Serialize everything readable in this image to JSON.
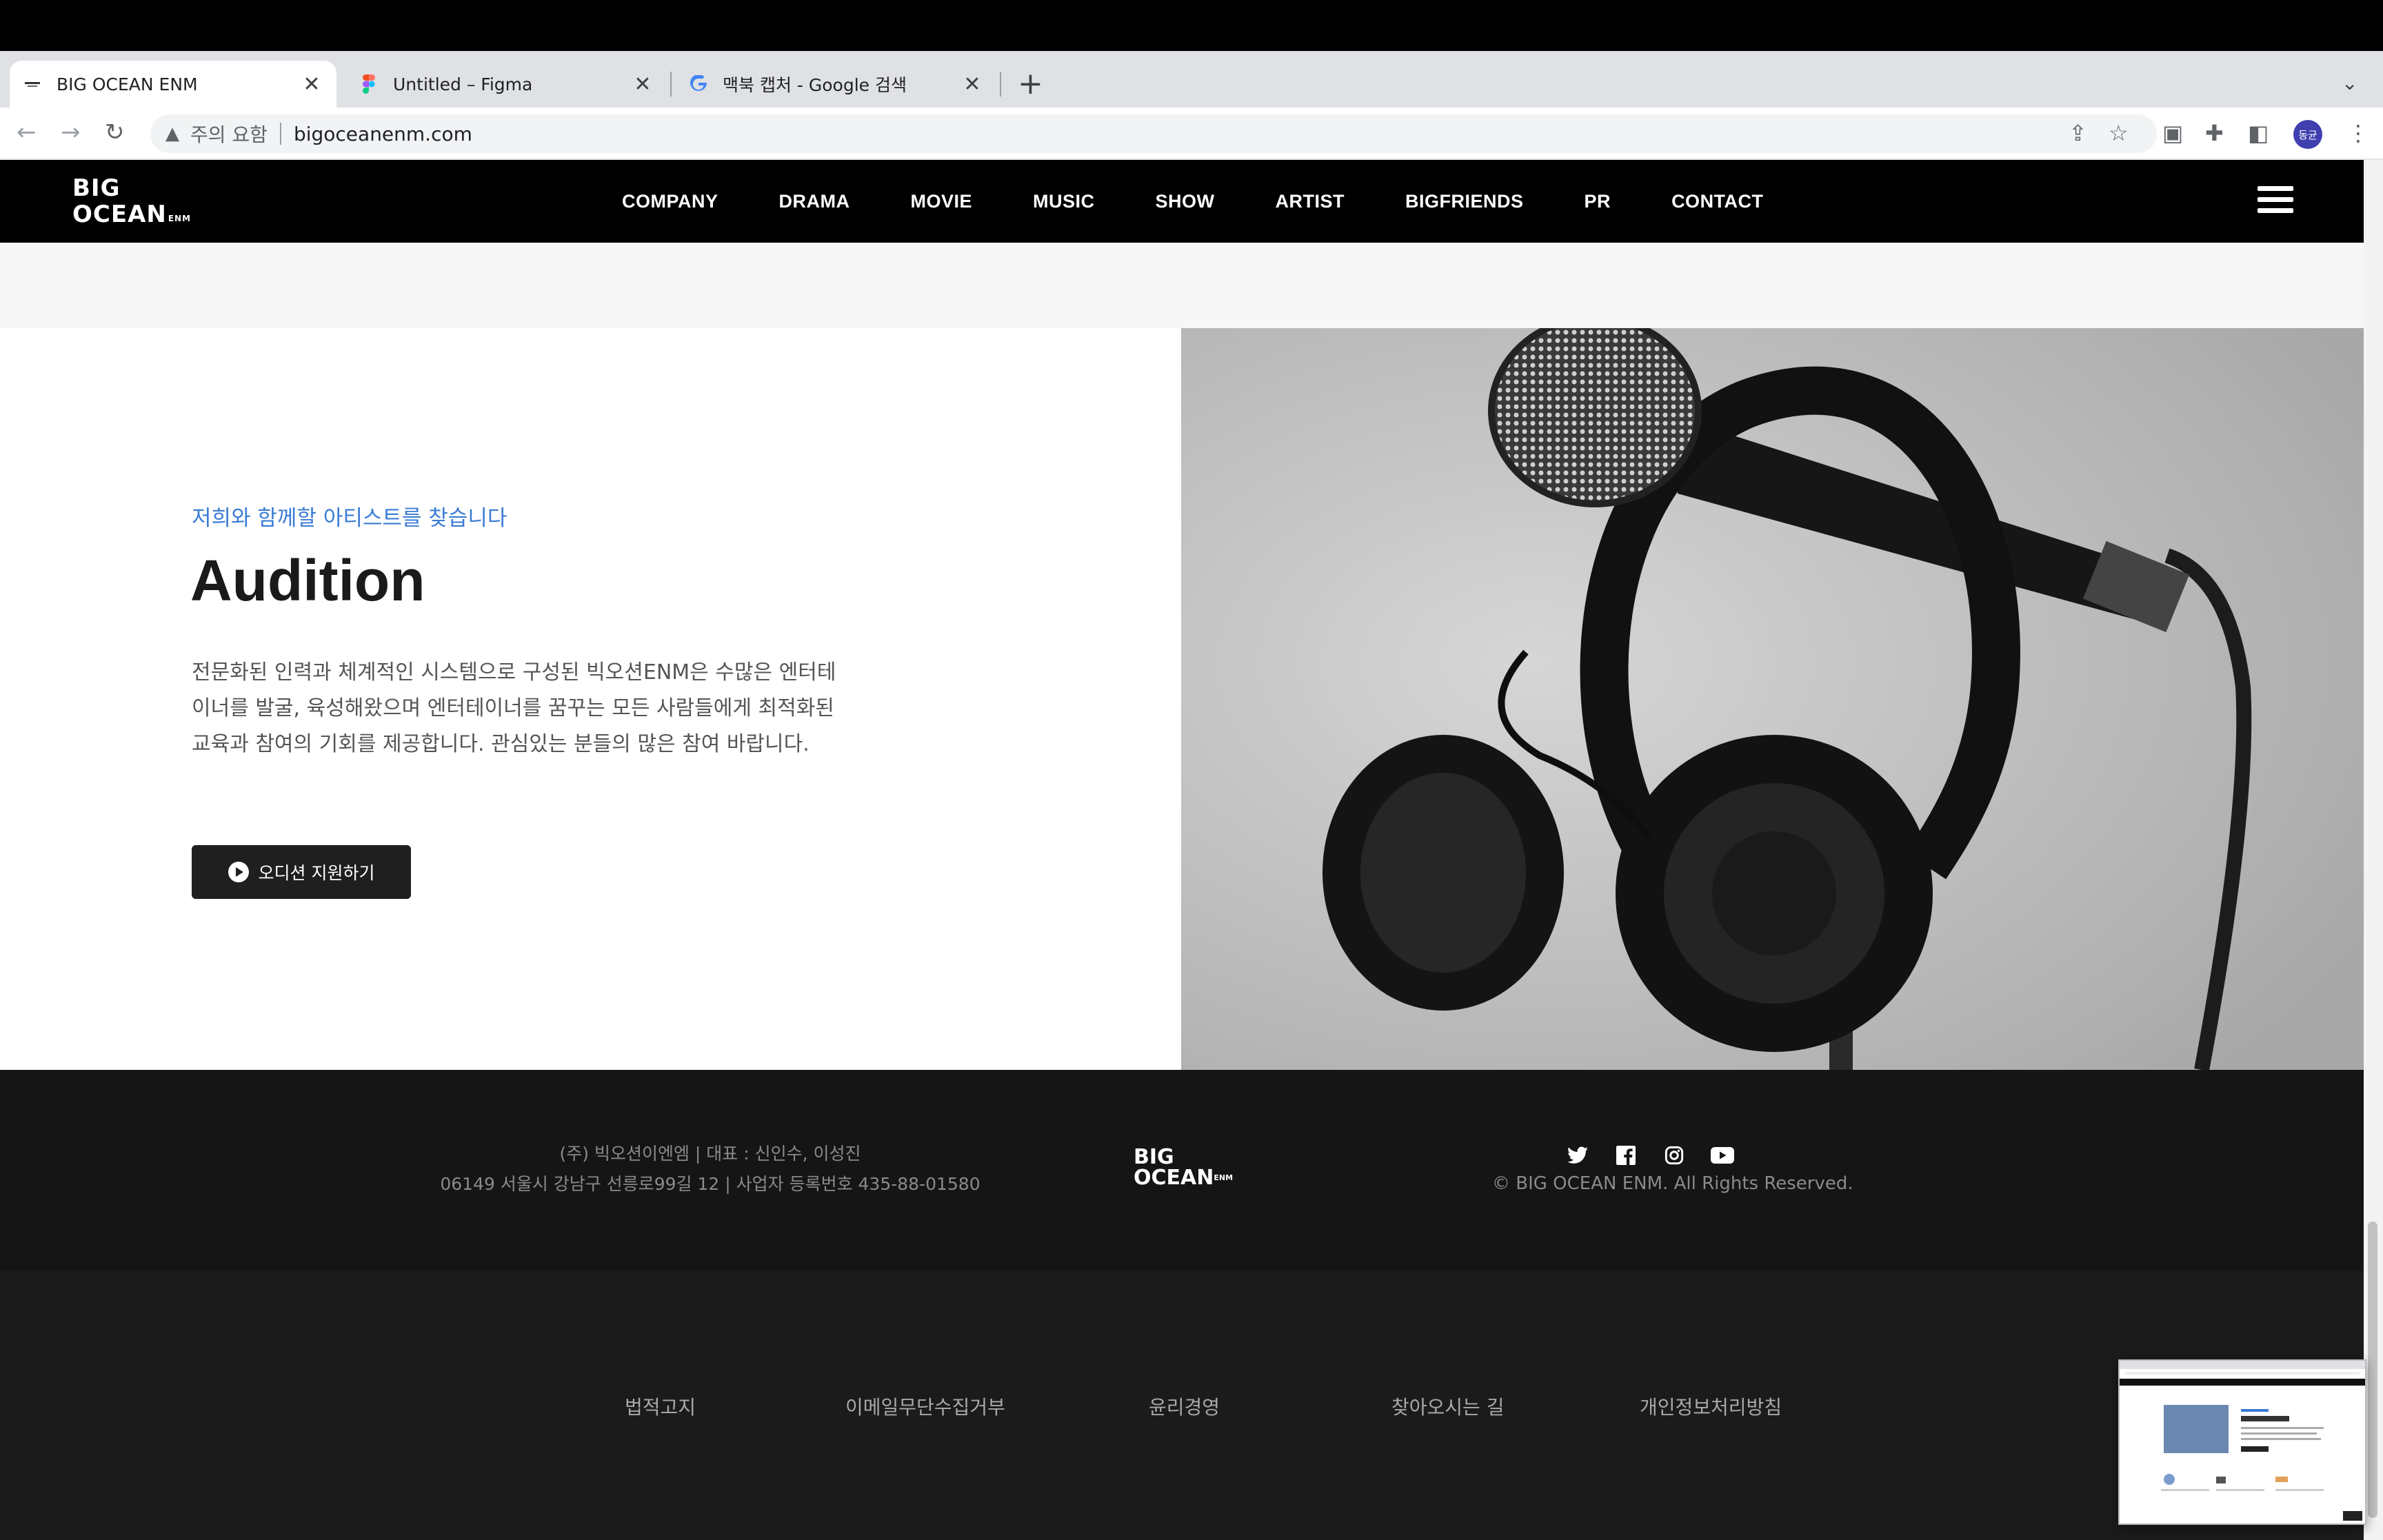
{
  "browser": {
    "tabs": [
      {
        "title": "BIG OCEAN ENM",
        "close": "✕"
      },
      {
        "title": "Untitled – Figma",
        "close": "✕"
      },
      {
        "title": "맥북 캡처 - Google 검색",
        "close": "✕"
      }
    ],
    "new_tab": "+",
    "tab_menu": "⌄",
    "back": "←",
    "forward": "→",
    "reload": "↻",
    "security_warning": "주의 요함",
    "url": "bigoceanenm.com",
    "profile_initials": "동균"
  },
  "site": {
    "logo_line1": "BIG",
    "logo_line2": "OCEAN",
    "logo_suffix": "ENM",
    "nav": [
      "COMPANY",
      "DRAMA",
      "MOVIE",
      "MUSIC",
      "SHOW",
      "ARTIST",
      "BIGFRIENDS",
      "PR",
      "CONTACT"
    ]
  },
  "audition": {
    "subtitle": "저희와 함께할 아티스트를 찾습니다",
    "title": "Audition",
    "description": "전문화된 인력과 체계적인 시스템으로 구성된 빅오션ENM은 수많은 엔터테이너를 발굴, 육성해왔으며 엔터테이너를 꿈꾸는 모든 사람들에게 최적화된 교육과 참여의 기회를 제공합니다. 관심있는 분들의 많은 참여 바랍니다.",
    "button_label": "오디션 지원하기"
  },
  "footer": {
    "company_line": "(주) 빅오션이엔엠 | 대표 : 신인수, 이성진",
    "address_line": "06149 서울시 강남구 선릉로99길 12 | 사업자 등록번호 435-88-01580",
    "logo_line1": "BIG",
    "logo_line2": "OCEAN",
    "logo_suffix": "ENM",
    "social_icons": [
      "twitter-icon",
      "facebook-icon",
      "instagram-icon",
      "youtube-icon"
    ],
    "copyright": "© BIG OCEAN ENM. All Rights Reserved.",
    "links": [
      "법적고지",
      "이메일무단수집거부",
      "윤리경영",
      "찾아오시는 길",
      "개인정보처리방침"
    ]
  },
  "colors": {
    "accent_blue": "#3a7bd5",
    "header_bg": "#000000",
    "footer_bg": "#151515"
  }
}
